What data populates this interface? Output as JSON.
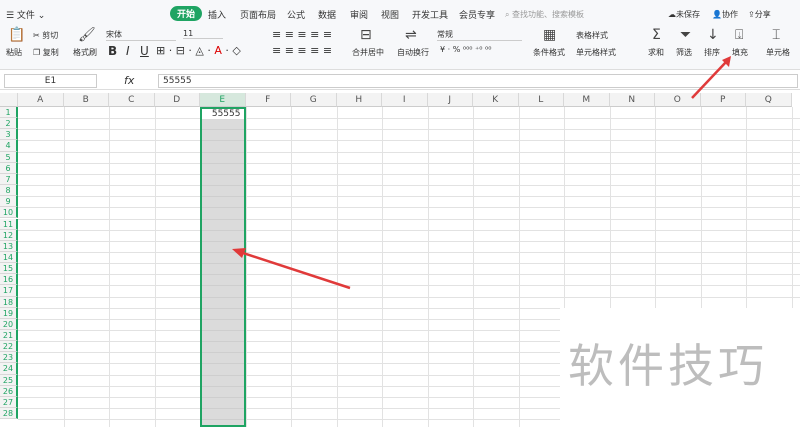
{
  "menu": {
    "items": [
      "☰ 文件 ⌄",
      "开始",
      "插入",
      "页面布局",
      "公式",
      "数据",
      "审阅",
      "视图",
      "开发工具",
      "会员专享"
    ],
    "search_placeholder": "查找功能、搜索模板",
    "unsaved": "未保存",
    "collab": "协作",
    "share": "分享"
  },
  "ribbon": {
    "paste": "粘贴",
    "cut": "剪切",
    "copy": "复制",
    "format_painter": "格式刷",
    "font": "宋体",
    "size": "11",
    "merge": "合并居中",
    "wrap": "自动换行",
    "number_format": "常规",
    "cond_format": "条件格式",
    "table_style": "表格样式",
    "cell_style": "单元格样式",
    "sum": "求和",
    "filter": "筛选",
    "sort": "排序",
    "fill": "填充",
    "cells": "单元格"
  },
  "formula": {
    "name_box": "E1",
    "fx": "fx",
    "value": "55555"
  },
  "columns": [
    "A",
    "B",
    "C",
    "D",
    "E",
    "F",
    "G",
    "H",
    "I",
    "J",
    "K",
    "L",
    "M",
    "N",
    "O",
    "P",
    "Q"
  ],
  "rows": 28,
  "cell_E1": "55555",
  "selected_column": "E",
  "watermark": "软件技巧",
  "colors": {
    "accent": "#1fa463",
    "selection": "#d9d9d9",
    "arrow": "#e03a3a"
  }
}
